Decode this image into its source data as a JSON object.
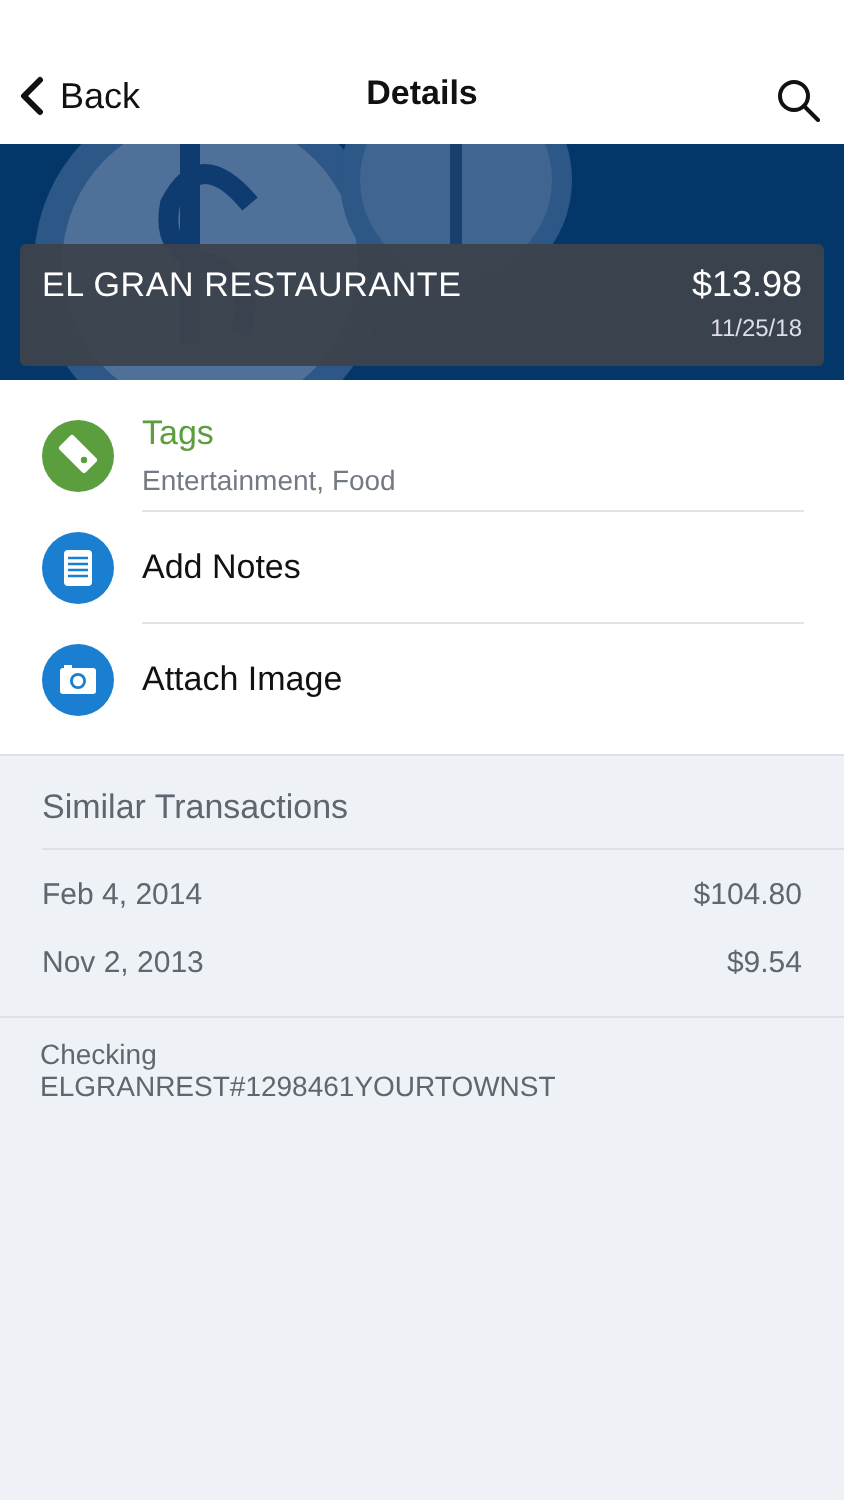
{
  "nav": {
    "back": "Back",
    "title": "Details"
  },
  "transaction": {
    "merchant": "EL GRAN RESTAURANTE",
    "amount": "$13.98",
    "date": "11/25/18"
  },
  "actions": [
    {
      "kind": "tag",
      "title": "Tags",
      "subtitle": "Entertainment, Food",
      "highlighted": true,
      "color": "#5a9e3e"
    },
    {
      "kind": "notes",
      "title": "Add Notes",
      "highlighted": false,
      "color": "#1a7fd0"
    },
    {
      "kind": "camera",
      "title": "Attach Image",
      "highlighted": false,
      "color": "#1a7fd0"
    }
  ],
  "similar": {
    "title": "Similar Transactions",
    "rows": [
      {
        "date": "Feb 4, 2014",
        "amount": "$104.80"
      },
      {
        "date": "Nov 2, 2013",
        "amount": "$9.54"
      }
    ]
  },
  "account": {
    "name": "Checking",
    "description": "ELGRANREST#1298461YOURTOWNST"
  }
}
